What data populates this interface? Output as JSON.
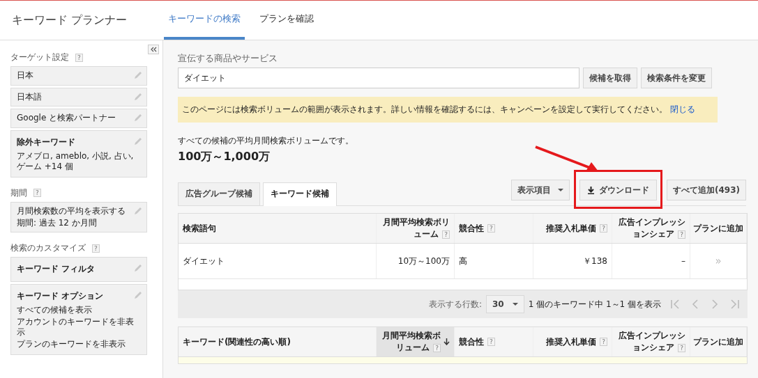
{
  "app_title": "キーワード プランナー",
  "nav_tabs": [
    {
      "label": "キーワードの検索",
      "selected": true
    },
    {
      "label": "プランを確認",
      "selected": false
    }
  ],
  "sidebar": [
    {
      "title": "ターゲット設定",
      "help": "?",
      "cards": [
        {
          "lines": [
            "日本"
          ]
        },
        {
          "lines": [
            "日本語"
          ]
        },
        {
          "lines": [
            "Google と検索パートナー"
          ]
        },
        {
          "heading": "除外キーワード",
          "lines": [
            "アメブロ, ameblo, 小説, 占い, ゲーム +14 個"
          ]
        }
      ]
    },
    {
      "title": "期間",
      "help": "?",
      "cards": [
        {
          "lines": [
            "月間検索数の平均を表示する",
            "期間: 過去 12 か月間"
          ]
        }
      ]
    },
    {
      "title": "検索のカスタマイズ",
      "help": "?",
      "cards": [
        {
          "heading": "キーワード フィルタ"
        },
        {
          "heading": "キーワード オプション",
          "lines": [
            "すべての候補を表示",
            "アカウントのキーワードを非表示",
            "プランのキーワードを非表示"
          ]
        }
      ]
    }
  ],
  "search": {
    "label": "宣伝する商品やサービス",
    "value": "ダイエット",
    "buttons": [
      "候補を取得",
      "検索条件を変更"
    ]
  },
  "notice": {
    "text": "このページには検索ボリュームの範囲が表示されます。詳しい情報を確認するには、キャンペーンを設定して実行してください。",
    "link": "閉じる"
  },
  "summary": {
    "caption": "すべての候補の平均月間検索ボリュームです。",
    "value": "100万～1,000万"
  },
  "result_tabs": [
    {
      "label": "広告グループ候補",
      "selected": false
    },
    {
      "label": "キーワード候補",
      "selected": true
    }
  ],
  "toolbar": {
    "columns_button": "表示項目",
    "download_button": "ダウンロード",
    "add_all_button": "すべて追加(493)"
  },
  "search_terms_table": {
    "columns": [
      {
        "label": "検索語句"
      },
      {
        "label": "月間平均検索ボリューム",
        "help": "?"
      },
      {
        "label": "競合性",
        "help": "?"
      },
      {
        "label": "推奨入札単価",
        "help": "?"
      },
      {
        "label": "広告インプレッションシェア",
        "help": "?"
      },
      {
        "label": "プランに追加"
      }
    ],
    "rows": [
      [
        "ダイエット",
        "10万～100万",
        "高",
        "￥138",
        "–",
        "»"
      ]
    ]
  },
  "pagination": {
    "rows_label": "表示する行数:",
    "rows_value": "30",
    "range": "1 個のキーワード中 1～1 個を表示"
  },
  "keywords_table": {
    "columns": [
      {
        "label": "キーワード(関連性の高い順)",
        "sorted": false
      },
      {
        "label": "月間平均検索ボリューム",
        "help": "?",
        "sorted": true
      },
      {
        "label": "競合性",
        "help": "?",
        "sorted": false
      },
      {
        "label": "推奨入札単価",
        "help": "?",
        "sorted": false
      },
      {
        "label": "広告インプレッションシェア",
        "help": "?",
        "sorted": false
      },
      {
        "label": "プランに追加",
        "sorted": false
      }
    ]
  }
}
